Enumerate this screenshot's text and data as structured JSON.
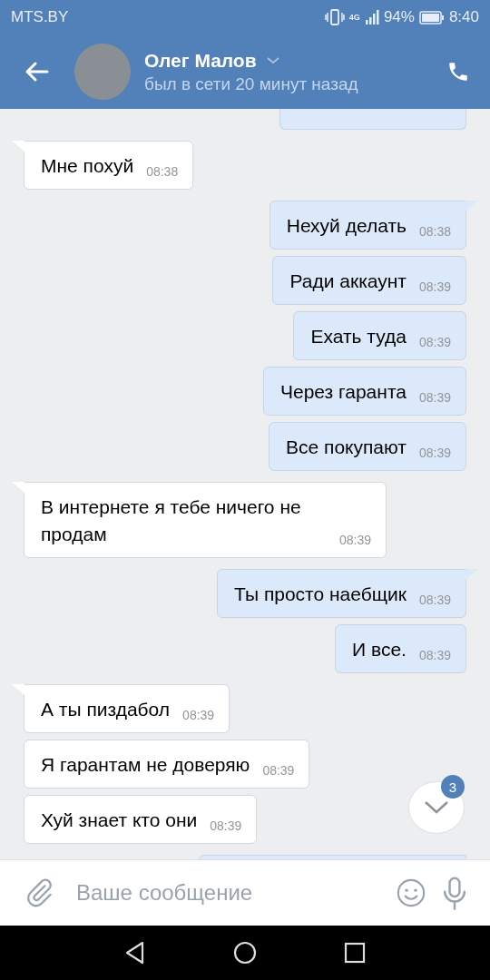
{
  "status_bar": {
    "carrier": "MTS.BY",
    "network": "4G",
    "battery": "94%",
    "time": "8:40"
  },
  "header": {
    "name": "Олег Малов",
    "status": "был в сети 20 минут назад"
  },
  "messages": [
    {
      "kind": "incoming",
      "text": "Мне похуй",
      "time": "08:38"
    },
    {
      "kind": "outgoing",
      "text": "Нехуй делать",
      "time": "08:38"
    },
    {
      "kind": "outgoing",
      "text": "Ради аккаунт",
      "time": "08:39"
    },
    {
      "kind": "outgoing",
      "text": "Ехать туда",
      "time": "08:39"
    },
    {
      "kind": "outgoing",
      "text": "Через гаранта",
      "time": "08:39"
    },
    {
      "kind": "outgoing",
      "text": "Все покупают",
      "time": "08:39"
    },
    {
      "kind": "incoming",
      "text": "В интернете я тебе ничего не продам",
      "time": "08:39"
    },
    {
      "kind": "outgoing",
      "text": "Ты просто наебщик",
      "time": "08:39"
    },
    {
      "kind": "outgoing",
      "text": "И все.",
      "time": "08:39"
    },
    {
      "kind": "incoming",
      "text": "А ты пиздабол",
      "time": "08:39"
    },
    {
      "kind": "incoming",
      "text": "Я гарантам не доверяю",
      "time": "08:39"
    },
    {
      "kind": "incoming",
      "text": "Хуй знает кто они",
      "time": "08:39"
    }
  ],
  "unread_badge": "3",
  "composer": {
    "placeholder": "Ваше сообщение"
  }
}
